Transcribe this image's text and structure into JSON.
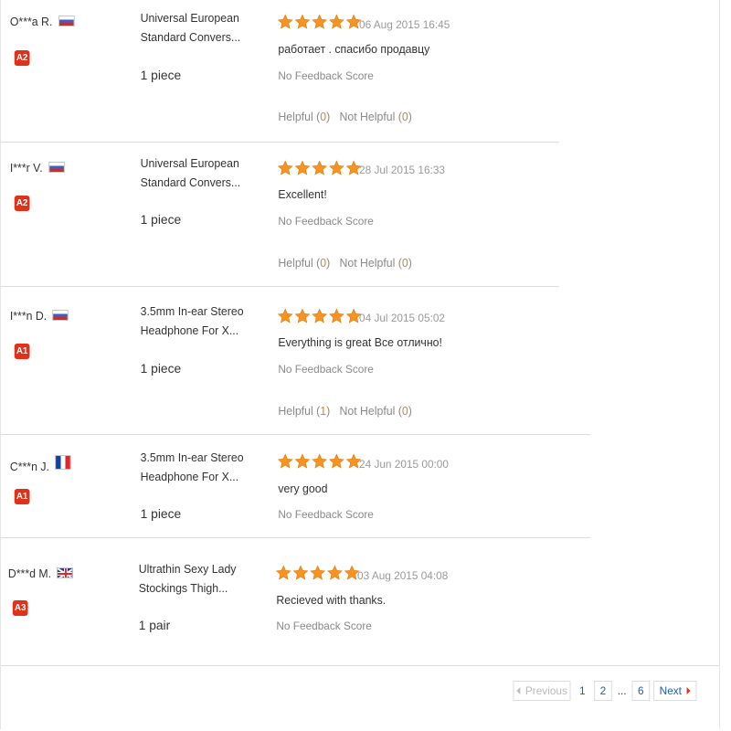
{
  "reviews": [
    {
      "user": "O***a R.",
      "flag": "ru",
      "level": "A2",
      "product": "Universal European Standard Convers...",
      "quantity": "1 piece",
      "rating": 5,
      "date": "06 Aug 2015 16:45",
      "text": "работает . спасибо продавцу",
      "feedback": "No Feedback Score",
      "helpful_label": "Helpful",
      "helpful_count": "0",
      "not_helpful_label": "Not Helpful",
      "not_helpful_count": "0"
    },
    {
      "user": "I***r V.",
      "flag": "ru",
      "level": "A2",
      "product": "Universal European Standard Convers...",
      "quantity": "1 piece",
      "rating": 5,
      "date": "28 Jul 2015 16:33",
      "text": "Excellent!",
      "feedback": "No Feedback Score",
      "helpful_label": "Helpful",
      "helpful_count": "0",
      "not_helpful_label": "Not Helpful",
      "not_helpful_count": "0"
    },
    {
      "user": "I***n D.",
      "flag": "ru",
      "level": "A1",
      "product": "3.5mm In-ear Stereo Headphone For X...",
      "quantity": "1 piece",
      "rating": 5,
      "date": "04 Jul 2015 05:02",
      "text": "Everything is great Все отлично!",
      "feedback": "No Feedback Score",
      "helpful_label": "Helpful",
      "helpful_count": "1",
      "not_helpful_label": "Not Helpful",
      "not_helpful_count": "0"
    },
    {
      "user": "C***n J.",
      "flag": "fr",
      "level": "A1",
      "product": "3.5mm In-ear Stereo Headphone For X...",
      "quantity": "1 piece",
      "rating": 5,
      "date": "24 Jun 2015 00:00",
      "text": "very good",
      "feedback": "No Feedback Score"
    },
    {
      "user": "D***d M.",
      "flag": "uk",
      "level": "A3",
      "product": "Ultrathin Sexy Lady Stockings Thigh...",
      "quantity": "1 pair",
      "rating": 5,
      "date": "03 Aug 2015 04:08",
      "text": "Recieved with thanks.",
      "feedback": "No Feedback Score"
    }
  ],
  "pagination": {
    "previous": "Previous",
    "current": "1",
    "page2": "2",
    "ellipsis": "...",
    "last": "6",
    "next": "Next"
  },
  "colors": {
    "star": "#f7931e",
    "badge": "#e0311b",
    "link": "#1a5fb4",
    "helpful_count": "#e67e22"
  }
}
